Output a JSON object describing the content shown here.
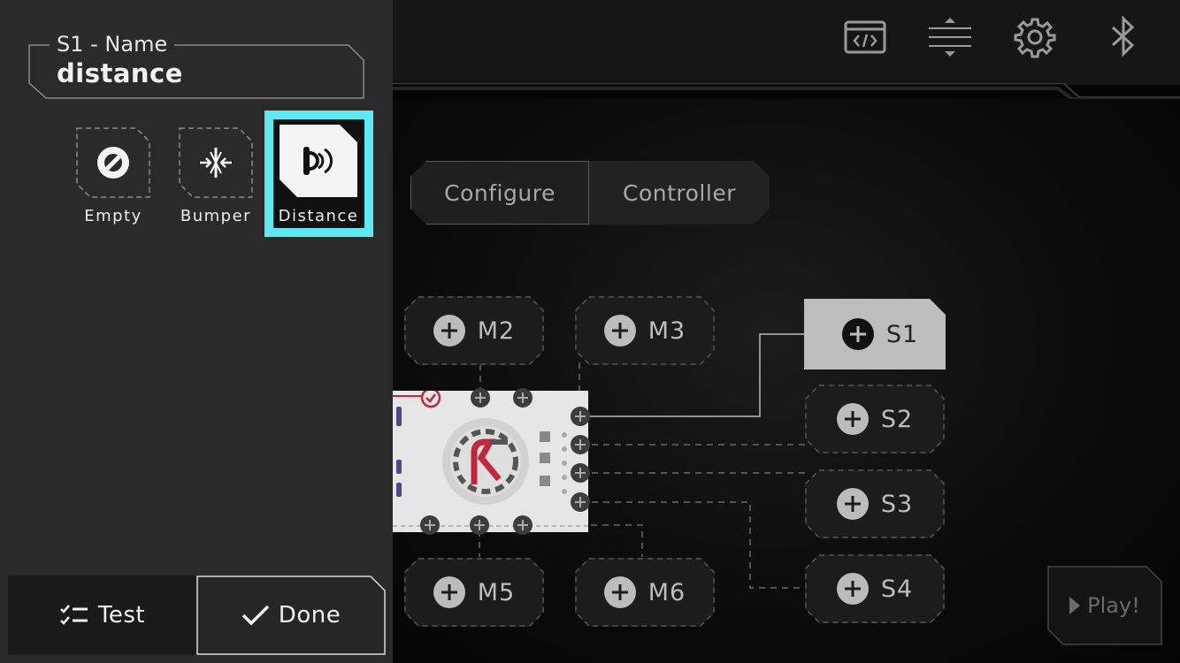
{
  "colors": {
    "accent": "#5ee8f2",
    "warning": "#c2283a"
  },
  "panel": {
    "name_label": "S1 - Name",
    "name_value": "distance",
    "sensor_types": [
      {
        "label": "Empty",
        "icon": "empty-icon"
      },
      {
        "label": "Bumper",
        "icon": "bumper-icon"
      },
      {
        "label": "Distance",
        "icon": "distance-sensor-icon",
        "selected": true
      }
    ],
    "test_label": "Test",
    "done_label": "Done"
  },
  "toolbar": {
    "icons": [
      "code-icon",
      "resize-icon",
      "settings-icon",
      "bluetooth-icon"
    ]
  },
  "tabs": [
    {
      "label": "Configure",
      "active": true
    },
    {
      "label": "Controller",
      "active": false
    }
  ],
  "ports": {
    "motors": [
      "M2",
      "M3",
      "M5",
      "M6"
    ],
    "sensors": [
      "S1",
      "S2",
      "S3",
      "S4"
    ],
    "selected": "S1"
  },
  "play_label": "Play!"
}
